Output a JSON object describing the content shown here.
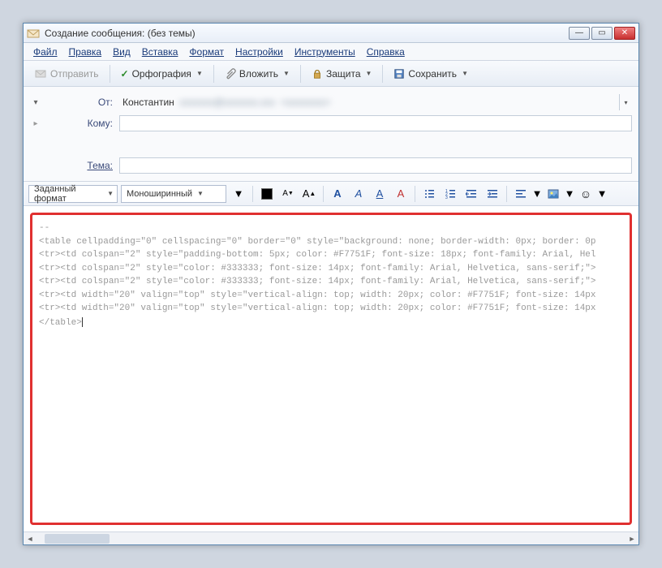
{
  "window": {
    "title": "Создание сообщения: (без темы)"
  },
  "menu": {
    "file": "Файл",
    "edit": "Правка",
    "view": "Вид",
    "insert": "Вставка",
    "format": "Формат",
    "settings": "Настройки",
    "tools": "Инструменты",
    "help": "Справка"
  },
  "toolbar": {
    "send": "Отправить",
    "spell": "Орфография",
    "attach": "Вложить",
    "security": "Защита",
    "save": "Сохранить"
  },
  "headers": {
    "from_label": "От:",
    "from_value": "Константин",
    "to_label": "Кому:",
    "to_value": "",
    "subject_label": "Тема:",
    "subject_value": ""
  },
  "formatbar": {
    "paragraph_style": "Заданный формат",
    "font_family": "Моноширинный"
  },
  "body_lines": [
    "--",
    "<table cellpadding=\"0\" cellspacing=\"0\" border=\"0\" style=\"background: none; border-width: 0px; border: 0p",
    "<tr><td colspan=\"2\" style=\"padding-bottom: 5px; color: #F7751F; font-size: 18px; font-family: Arial, Hel",
    "<tr><td colspan=\"2\" style=\"color: #333333; font-size: 14px; font-family: Arial, Helvetica, sans-serif;\">",
    "<tr><td colspan=\"2\" style=\"color: #333333; font-size: 14px; font-family: Arial, Helvetica, sans-serif;\">",
    "<tr><td width=\"20\" valign=\"top\" style=\"vertical-align: top; width: 20px; color: #F7751F; font-size: 14px",
    "<tr><td width=\"20\" valign=\"top\" style=\"vertical-align: top; width: 20px; color: #F7751F; font-size: 14px",
    "</table>"
  ]
}
